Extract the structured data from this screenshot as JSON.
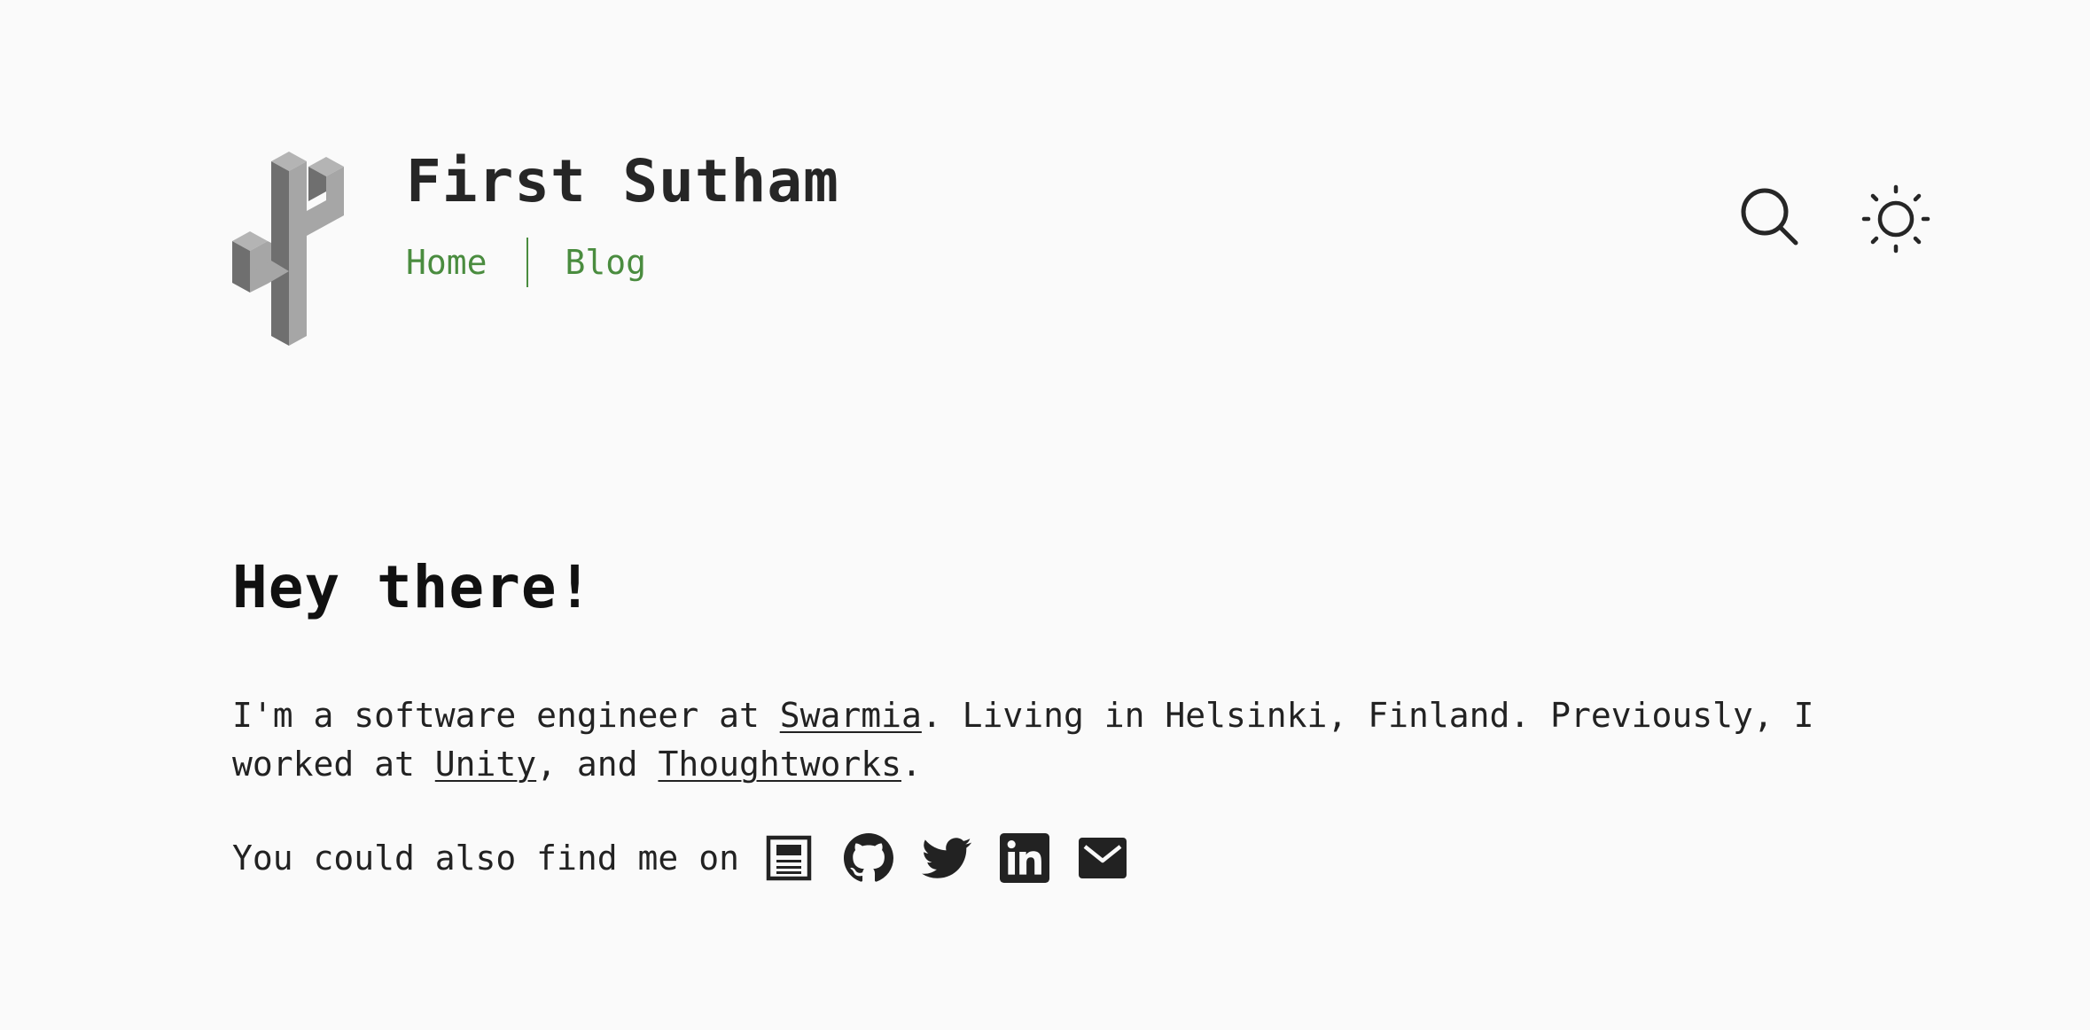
{
  "header": {
    "logo_icon": "isometric-cactus-logo-icon",
    "site_title": "First Sutham",
    "nav": [
      {
        "label": "Home"
      },
      {
        "label": "Blog"
      }
    ],
    "search_icon": "search-icon",
    "theme_icon": "sun-icon"
  },
  "main": {
    "heading": "Hey there!",
    "intro": {
      "part1": "I'm a software engineer at ",
      "link1": "Swarmia",
      "part2": ". Living in Helsinki, Finland. Previously, I worked at ",
      "link2": "Unity",
      "part3": ", and ",
      "link3": "Thoughtworks",
      "part4": "."
    },
    "social": {
      "label": "You could also find me on",
      "icons": [
        "resume-icon",
        "github-icon",
        "twitter-icon",
        "linkedin-icon",
        "email-icon"
      ]
    }
  },
  "colors": {
    "background": "#fafafa",
    "text": "#222222",
    "nav_accent": "#4a8c3f"
  }
}
